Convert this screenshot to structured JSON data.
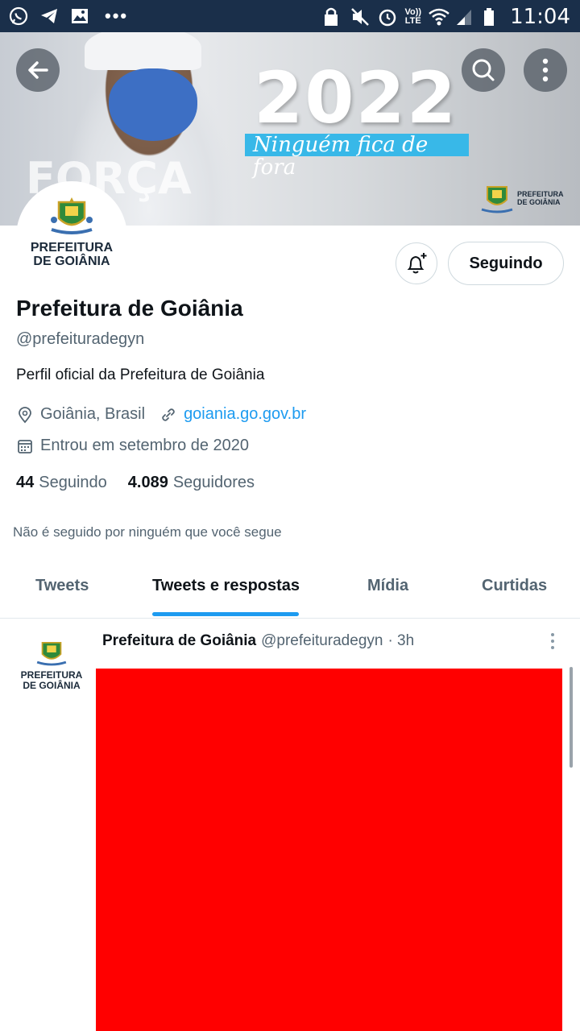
{
  "status_bar": {
    "time": "11:04",
    "network": "LTE",
    "volte": "Vo))",
    "left_icons": [
      "whatsapp-icon",
      "telegram-icon",
      "gallery-icon"
    ],
    "more": "•••"
  },
  "banner": {
    "year": "2022",
    "tagline": "Ninguém fica de fora",
    "overlay_text": "FORÇA",
    "logo_text_line1": "PREFEITURA",
    "logo_text_line2": "DE GOIÂNIA"
  },
  "profile": {
    "avatar_line1": "PREFEITURA",
    "avatar_line2": "DE GOIÂNIA",
    "name": "Prefeitura de Goiânia",
    "handle": "@prefeituradegyn",
    "bio": "Perfil oficial da Prefeitura de Goiânia",
    "location": "Goiânia, Brasil",
    "website": "goiania.go.gov.br",
    "joined": "Entrou em setembro de 2020",
    "following_count": "44",
    "following_label": "Seguindo",
    "followers_count": "4.089",
    "followers_label": "Seguidores",
    "not_followed": "Não é seguido por ninguém que você segue",
    "follow_button": "Seguindo"
  },
  "tabs": [
    {
      "label": "Tweets",
      "active": false
    },
    {
      "label": "Tweets e respostas",
      "active": true
    },
    {
      "label": "Mídia",
      "active": false
    },
    {
      "label": "Curtidas",
      "active": false
    }
  ],
  "tweet": {
    "author": "Prefeitura de Goiânia",
    "handle": "@prefeituradegyn",
    "time": "· 3h",
    "avatar_line1": "PREFEITURA",
    "avatar_line2": "DE GOIÂNIA"
  },
  "colors": {
    "status_bar": "#1a2f4a",
    "accent": "#1d9bf0",
    "redaction": "#ff0000",
    "banner_tag": "#38b8e8"
  }
}
